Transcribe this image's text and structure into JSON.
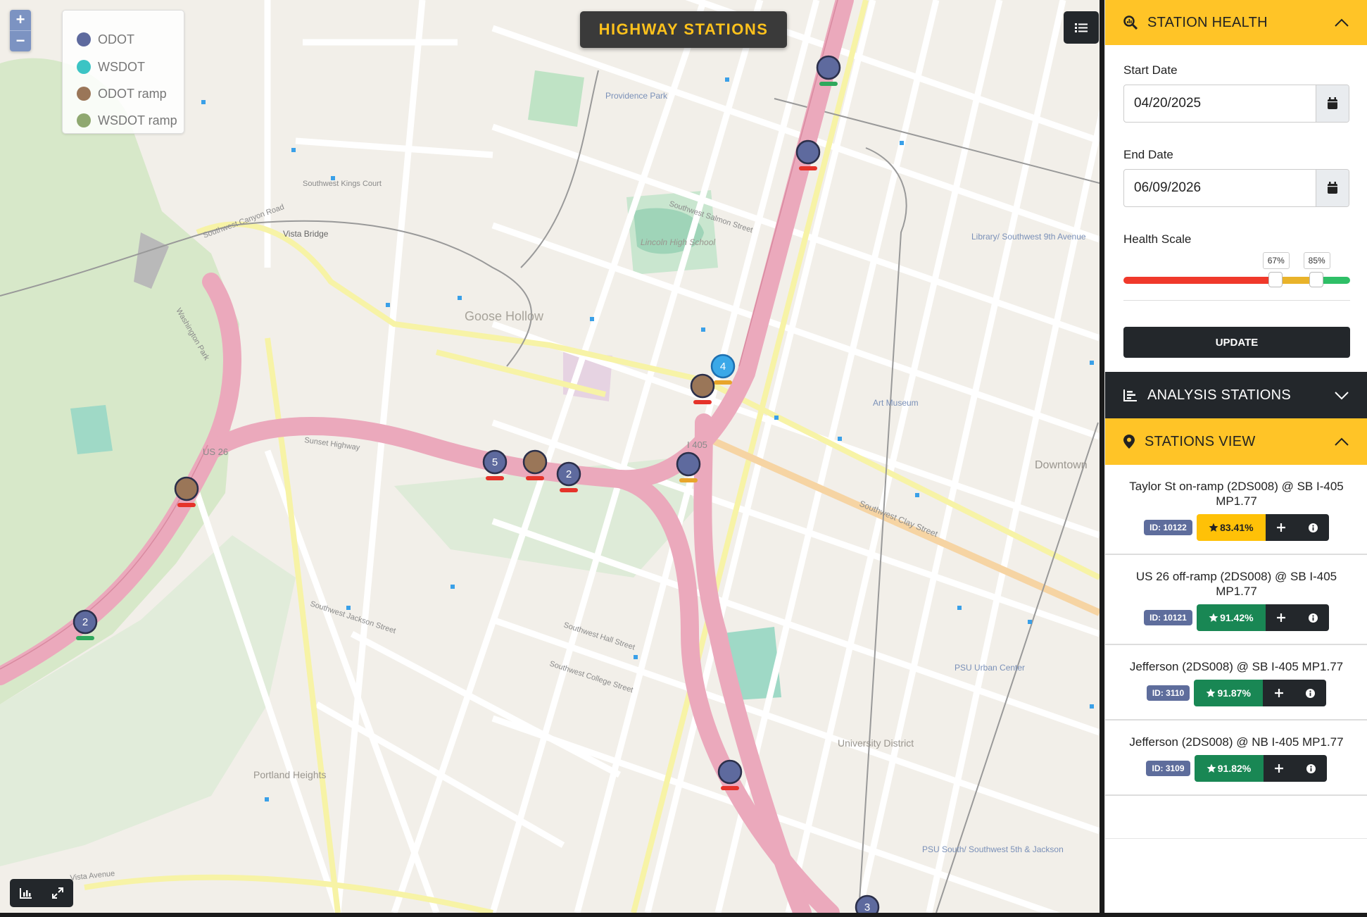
{
  "map": {
    "title": "HIGHWAY STATIONS",
    "zoom_in": "+",
    "zoom_out": "−",
    "legend": [
      {
        "label": "ODOT",
        "color": "#5e6a9e"
      },
      {
        "label": "WSDOT",
        "color": "#3cc4c4"
      },
      {
        "label": "ODOT ramp",
        "color": "#9a7658"
      },
      {
        "label": "WSDOT ramp",
        "color": "#8fa870"
      }
    ],
    "area_labels": {
      "goose_hollow": "Goose Hollow",
      "portland_heights": "Portland Heights",
      "downtown": "Downtown",
      "university_district": "University District",
      "lincoln_hs": "Lincoln High School",
      "providence_park": "Providence Park",
      "vista_bridge": "Vista Bridge",
      "sunset_highway": "Sunset Highway",
      "us26": "US 26",
      "i405": "I 405",
      "canyon_road": "Southwest Canyon Road",
      "kings_court": "Southwest Kings Court",
      "salmon_street": "Southwest Salmon Street",
      "clay_street": "Southwest Clay Street",
      "jackson_street": "Southwest Jackson Street",
      "hall_street": "Southwest Hall Street",
      "college_street": "Southwest College Street",
      "vista_avenue": "Vista Avenue",
      "washington_park": "Washington Park",
      "art_museum": "Art Museum",
      "psu_urban": "PSU Urban Center",
      "psu_south": "PSU South/ Southwest 5th & Jackson",
      "library": "Library/ Southwest 9th Avenue"
    },
    "markers": [
      {
        "type": "ODOT",
        "label": "",
        "status": "good"
      },
      {
        "type": "ODOT",
        "label": "",
        "status": "bad"
      },
      {
        "type": "WSDOT",
        "label": "4",
        "status": "warn"
      },
      {
        "type": "ODOT ramp",
        "label": "",
        "status": "bad"
      },
      {
        "type": "ODOT",
        "label": "",
        "status": "warn"
      },
      {
        "type": "ODOT",
        "label": "5",
        "status": "bad"
      },
      {
        "type": "ODOT ramp",
        "label": "",
        "status": "bad"
      },
      {
        "type": "ODOT",
        "label": "2",
        "status": "bad"
      },
      {
        "type": "ODOT ramp",
        "label": "",
        "status": "bad"
      },
      {
        "type": "ODOT",
        "label": "2",
        "status": "good"
      },
      {
        "type": "ODOT",
        "label": "",
        "status": "bad"
      },
      {
        "type": "ODOT",
        "label": "3",
        "status": "bad"
      }
    ]
  },
  "sidebar": {
    "health": {
      "title": "STATION HEALTH",
      "start_label": "Start Date",
      "start_value": "04/20/2025",
      "end_label": "End Date",
      "end_value": "06/09/2026",
      "scale_label": "Health Scale",
      "scale_low": "67%",
      "scale_high": "85%",
      "scale_low_value": 67,
      "scale_high_value": 85,
      "colors": {
        "bad": "#f0392b",
        "warn": "#e9b32a",
        "good": "#2fbf67"
      },
      "update_label": "UPDATE"
    },
    "analysis": {
      "title": "ANALYSIS STATIONS"
    },
    "stations_view": {
      "title": "STATIONS VIEW",
      "items": [
        {
          "name": "Taylor St on-ramp (2DS008) @ SB I-405 MP1.77",
          "id": "ID: 10122",
          "health": "83.41%",
          "level": "warn"
        },
        {
          "name": "US 26 off-ramp (2DS008) @ SB I-405 MP1.77",
          "id": "ID: 10121",
          "health": "91.42%",
          "level": "good"
        },
        {
          "name": "Jefferson (2DS008) @ SB I-405 MP1.77",
          "id": "ID: 3110",
          "health": "91.87%",
          "level": "good"
        },
        {
          "name": "Jefferson (2DS008) @ NB I-405 MP1.77",
          "id": "ID: 3109",
          "health": "91.82%",
          "level": "good"
        }
      ]
    }
  }
}
